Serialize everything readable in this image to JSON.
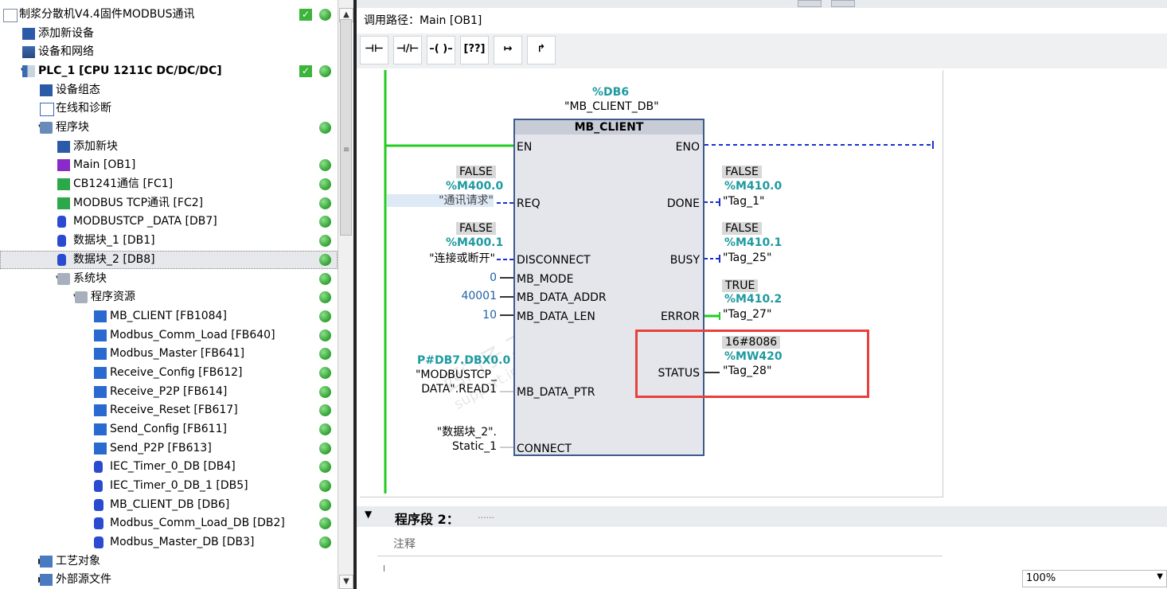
{
  "tree": {
    "items": [
      {
        "label": "制浆分散机V4.4固件MODBUS通讯",
        "icon": "project-icon",
        "check": true,
        "status": "ok"
      },
      {
        "label": "添加新设备",
        "icon": "add-device-icon"
      },
      {
        "label": "设备和网络",
        "icon": "network-icon"
      },
      {
        "label": "PLC_1 [CPU 1211C DC/DC/DC]",
        "icon": "plc-icon",
        "check": true,
        "status": "ok",
        "bold": true
      },
      {
        "label": "设备组态",
        "icon": "device-config-icon"
      },
      {
        "label": "在线和诊断",
        "icon": "diagnostics-icon"
      },
      {
        "label": "程序块",
        "icon": "folder-icon",
        "status": "ok"
      },
      {
        "label": "添加新块",
        "icon": "add-block-icon"
      },
      {
        "label": "Main [OB1]",
        "icon": "ob-block-icon",
        "status": "ok"
      },
      {
        "label": "CB1241通信 [FC1]",
        "icon": "fc-block-icon",
        "status": "ok"
      },
      {
        "label": "MODBUS TCP通讯 [FC2]",
        "icon": "fc-block-icon",
        "status": "ok"
      },
      {
        "label": "MODBUSTCP _DATA [DB7]",
        "icon": "db-icon",
        "status": "ok"
      },
      {
        "label": "数据块_1 [DB1]",
        "icon": "db-icon",
        "status": "ok"
      },
      {
        "label": "数据块_2 [DB8]",
        "icon": "db-icon",
        "status": "ok",
        "selected": true
      },
      {
        "label": "系统块",
        "icon": "folder-gray-icon",
        "status": "ok"
      },
      {
        "label": "程序资源",
        "icon": "folder-gray-icon",
        "status": "ok"
      },
      {
        "label": "MB_CLIENT [FB1084]",
        "icon": "fb-block-icon",
        "status": "ok"
      },
      {
        "label": "Modbus_Comm_Load [FB640]",
        "icon": "fb-block-icon",
        "status": "ok"
      },
      {
        "label": "Modbus_Master [FB641]",
        "icon": "fb-block-icon",
        "status": "ok"
      },
      {
        "label": "Receive_Config [FB612]",
        "icon": "fb-block-icon",
        "status": "ok"
      },
      {
        "label": "Receive_P2P [FB614]",
        "icon": "fb-block-icon",
        "status": "ok"
      },
      {
        "label": "Receive_Reset [FB617]",
        "icon": "fb-block-icon",
        "status": "ok"
      },
      {
        "label": "Send_Config [FB611]",
        "icon": "fb-block-icon",
        "status": "ok"
      },
      {
        "label": "Send_P2P [FB613]",
        "icon": "fb-block-icon",
        "status": "ok"
      },
      {
        "label": "IEC_Timer_0_DB [DB4]",
        "icon": "db-icon",
        "status": "ok"
      },
      {
        "label": "IEC_Timer_0_DB_1 [DB5]",
        "icon": "db-icon",
        "status": "ok"
      },
      {
        "label": "MB_CLIENT_DB [DB6]",
        "icon": "instance-db-icon",
        "status": "ok"
      },
      {
        "label": "Modbus_Comm_Load_DB [DB2]",
        "icon": "instance-db-icon",
        "status": "ok"
      },
      {
        "label": "Modbus_Master_DB [DB3]",
        "icon": "instance-db-icon",
        "status": "ok"
      },
      {
        "label": "工艺对象",
        "icon": "tech-object-icon"
      },
      {
        "label": "外部源文件",
        "icon": "external-source-icon"
      }
    ]
  },
  "editor": {
    "call_path_label": "调用路径：",
    "call_path_value": "Main [OB1]",
    "toolbar": [
      {
        "name": "normally-open-contact-icon",
        "glyph": "⊣⊢"
      },
      {
        "name": "normally-closed-contact-icon",
        "glyph": "⊣/⊢"
      },
      {
        "name": "coil-icon",
        "glyph": "–( )–"
      },
      {
        "name": "empty-box-icon",
        "glyph": "[??]"
      },
      {
        "name": "open-branch-icon",
        "glyph": "↦"
      },
      {
        "name": "close-branch-icon",
        "glyph": "↱"
      }
    ],
    "fb": {
      "instance_addr": "%DB6",
      "instance_name": "\"MB_CLIENT_DB\"",
      "type": "MB_CLIENT",
      "pin_en": "EN",
      "pin_eno": "ENO",
      "pin_req": "REQ",
      "pin_disconnect": "DISCONNECT",
      "pin_mb_mode": "MB_MODE",
      "pin_mb_data_addr": "MB_DATA_ADDR",
      "pin_mb_data_len": "MB_DATA_LEN",
      "pin_mb_data_ptr": "MB_DATA_PTR",
      "pin_connect": "CONNECT",
      "pin_done": "DONE",
      "pin_busy": "BUSY",
      "pin_error": "ERROR",
      "pin_status": "STATUS"
    },
    "inputs": {
      "req_value": "FALSE",
      "req_addr": "%M400.0",
      "req_tag": "\"通讯请求\"",
      "disc_value": "FALSE",
      "disc_addr": "%M400.1",
      "disc_tag": "\"连接或断开\"",
      "mb_mode": "0",
      "mb_data_addr": "40001",
      "mb_data_len": "10",
      "ptr_addr": "P#DB7.DBX0.0",
      "ptr_tag_1": "\"MODBUSTCP_",
      "ptr_tag_2": "DATA\".READ1",
      "connect_tag_1": "\"数据块_2\".",
      "connect_tag_2": "Static_1"
    },
    "outputs": {
      "done_value": "FALSE",
      "done_addr": "%M410.0",
      "done_tag": "\"Tag_1\"",
      "busy_value": "FALSE",
      "busy_addr": "%M410.1",
      "busy_tag": "\"Tag_25\"",
      "error_value": "TRUE",
      "error_addr": "%M410.2",
      "error_tag": "\"Tag_27\"",
      "status_value": "16#8086",
      "status_addr": "%MW420",
      "status_tag": "\"Tag_28\""
    },
    "watermark_1": "西门子 工业 找答案",
    "watermark_2": "support.industry.siemens.com",
    "segment2_label": "程序段 2：",
    "segment2_dots": "......",
    "comment_label": "注释",
    "zoom": "100%"
  },
  "colors": {
    "power_rail": "#22cc22",
    "teal_addr": "#1f9aa0",
    "highlight_box": "#e8403c",
    "fb_border": "#3c5a8c",
    "dashed_blue": "#1a2fd0"
  }
}
